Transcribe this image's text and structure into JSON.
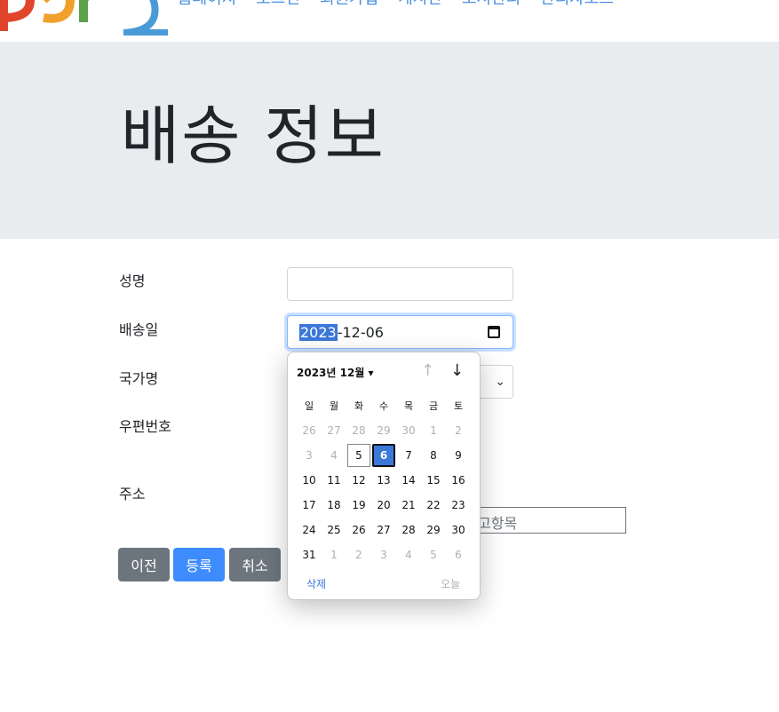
{
  "nav": {
    "links": [
      "홈페이지",
      "로그인",
      "회원가입",
      "게시판",
      "도서관리",
      "관리자모드"
    ]
  },
  "header": {
    "title": "배송 정보"
  },
  "form": {
    "name_label": "성명",
    "date_label": "배송일",
    "date_year": "2023",
    "date_rest": "-12-06",
    "country_label": "국가명",
    "zip_label": "우편번호",
    "address_label": "주소",
    "address_partial": "고항목"
  },
  "buttons": {
    "prev": "이전",
    "submit": "등록",
    "cancel": "취소"
  },
  "datepicker": {
    "month_label": "2023년 12월",
    "weekdays": [
      "일",
      "월",
      "화",
      "수",
      "목",
      "금",
      "토"
    ],
    "days": [
      "26",
      "27",
      "28",
      "29",
      "30",
      "1",
      "2",
      "3",
      "4",
      "5",
      "6",
      "7",
      "8",
      "9",
      "10",
      "11",
      "12",
      "13",
      "14",
      "15",
      "16",
      "17",
      "18",
      "19",
      "20",
      "21",
      "22",
      "23",
      "24",
      "25",
      "26",
      "27",
      "28",
      "29",
      "30",
      "31",
      "1",
      "2",
      "3",
      "4",
      "5",
      "6"
    ],
    "muted_indices": [
      0,
      1,
      2,
      3,
      4,
      5,
      6,
      7,
      8,
      36,
      37,
      38,
      39,
      40,
      41
    ],
    "today_index": 9,
    "selected_index": 10,
    "clear_label": "삭제",
    "today_label": "오늘"
  },
  "colors": {
    "primary": "#3d8bfd",
    "secondary": "#6c757d",
    "jumbotron": "#e9ecef"
  }
}
